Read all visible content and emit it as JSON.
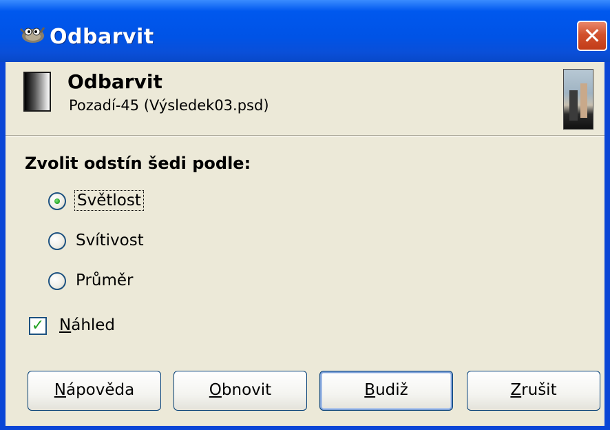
{
  "window": {
    "title": "Odbarvit",
    "close_glyph": "✕",
    "app_icon": "gimp-wilber-icon",
    "colors": {
      "titlebar": "#0058ee",
      "client": "#ece9d8",
      "close": "#d2512d"
    }
  },
  "header": {
    "title": "Odbarvit",
    "subtitle": "Pozadí-45 (Výsledek03.psd)",
    "icon": "desaturate-gradient-icon",
    "thumbnail": "image-thumbnail"
  },
  "section": {
    "title": "Zvolit odstín šedi podle:"
  },
  "radios": [
    {
      "label": "Světlost",
      "checked": true,
      "focused": true
    },
    {
      "label": "Svítivost",
      "checked": false
    },
    {
      "label": "Průměr",
      "checked": false
    }
  ],
  "preview": {
    "label": "Náhled",
    "checked": true,
    "mnemonic": "N"
  },
  "buttons": [
    {
      "label": "Nápověda",
      "mnemonic": "N"
    },
    {
      "label": "Obnovit",
      "mnemonic": "O"
    },
    {
      "label": "Budiž",
      "mnemonic": "B",
      "default": true
    },
    {
      "label": "Zrušit",
      "mnemonic": "Z"
    }
  ]
}
